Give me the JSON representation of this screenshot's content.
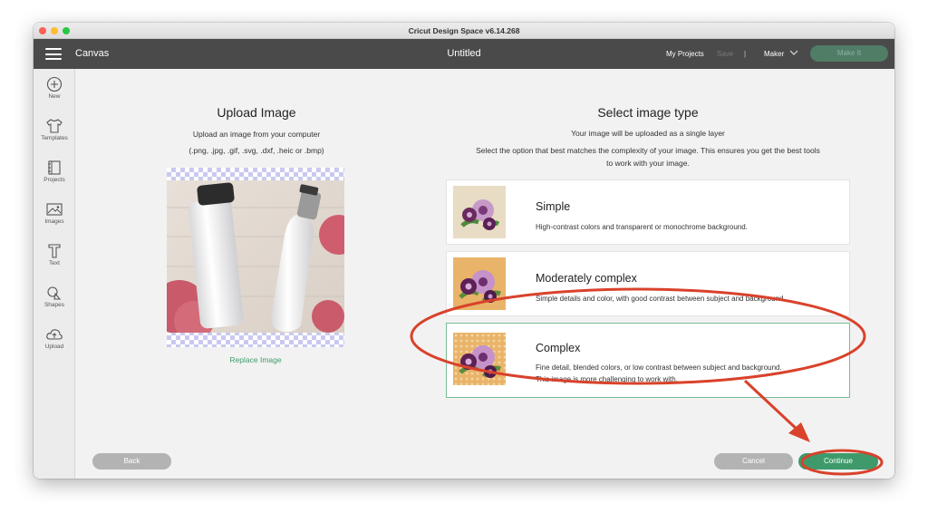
{
  "window": {
    "title": "Cricut Design Space  v6.14.268"
  },
  "appbar": {
    "canvas_label": "Canvas",
    "doc_title": "Untitled",
    "my_projects": "My Projects",
    "save": "Save",
    "separator": "|",
    "machine": "Maker",
    "make_it": "Make It"
  },
  "sidebar": {
    "items": [
      {
        "label": "New",
        "icon": "plus-circle-icon"
      },
      {
        "label": "Templates",
        "icon": "tshirt-icon"
      },
      {
        "label": "Projects",
        "icon": "notebook-icon"
      },
      {
        "label": "Images",
        "icon": "image-icon"
      },
      {
        "label": "Text",
        "icon": "text-t-icon"
      },
      {
        "label": "Shapes",
        "icon": "shapes-icon"
      },
      {
        "label": "Upload",
        "icon": "cloud-upload-icon"
      }
    ]
  },
  "upload": {
    "title": "Upload Image",
    "line1": "Upload an image from your computer",
    "line2": "(.png, .jpg, .gif, .svg, .dxf, .heic or .bmp)",
    "replace": "Replace Image"
  },
  "image_type": {
    "title": "Select image type",
    "subtitle": "Your image will be uploaded as a single layer",
    "instruction_line1": "Select the option that best matches the complexity of your image. This ensures you get the best tools",
    "instruction_line2": "to work with your image.",
    "options": [
      {
        "title": "Simple",
        "desc1": "High-contrast colors and transparent or monochrome background.",
        "desc2": ""
      },
      {
        "title": "Moderately complex",
        "desc1": "Simple details and color, with good contrast between subject and background.",
        "desc2": ""
      },
      {
        "title": "Complex",
        "desc1": "Fine detail, blended colors, or low contrast between subject and background.",
        "desc2": "This image is more challenging to work with.",
        "selected": true
      }
    ]
  },
  "footer": {
    "back": "Back",
    "cancel": "Cancel",
    "continue": "Continue"
  },
  "colors": {
    "accent_green": "#3f9a6b",
    "annotation_red": "#d9422b",
    "appbar": "#4a4a4a"
  }
}
